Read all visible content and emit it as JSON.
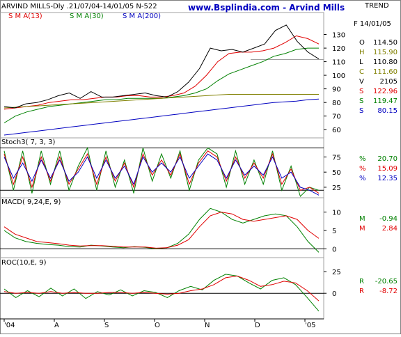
{
  "header": {
    "left_title": "ARVIND MILLS-Dly .21/07/04-14/01/05  N-522",
    "site_title": "www.Bsplindia.com - Arvind Mills",
    "trend_label": "TREND",
    "date_label": "F 14/01/05"
  },
  "colors": {
    "price": "#000000",
    "sma13": "#e00000",
    "sma30": "#008000",
    "sma200": "#0000c0",
    "extra_ma": "#808000",
    "stoch_k": "#008000",
    "stoch_d": "#e00000",
    "stoch_slow": "#0000c0",
    "site_title": "#0000c0"
  },
  "panels": {
    "price": {
      "legend": [
        {
          "text": "S M A(13)",
          "color": "#e00000"
        },
        {
          "text": "S M A(30)",
          "color": "#008000"
        },
        {
          "text": "S M A(200)",
          "color": "#0000c0"
        }
      ],
      "ohlc": [
        {
          "label": "O",
          "value": "114.50",
          "color": "#000000"
        },
        {
          "label": "H",
          "value": "115.90",
          "color": "#808000"
        },
        {
          "label": "L",
          "value": "110.80",
          "color": "#000000"
        },
        {
          "label": "C",
          "value": "111.60",
          "color": "#808000"
        },
        {
          "label": "V",
          "value": "2105",
          "color": "#000000"
        },
        {
          "label": "S",
          "value": "122.96",
          "color": "#e00000"
        },
        {
          "label": "S",
          "value": "119.47",
          "color": "#008000"
        },
        {
          "label": "S",
          "value": "80.15",
          "color": "#0000c0"
        }
      ]
    },
    "stoch": {
      "title": "Stoch3( 7, 3, 3)",
      "values": [
        {
          "label": "%",
          "value": "20.70",
          "color": "#008000"
        },
        {
          "label": "%",
          "value": "15.09",
          "color": "#e00000"
        },
        {
          "label": "%",
          "value": "12.35",
          "color": "#0000c0"
        }
      ]
    },
    "macd": {
      "title": "MACD( 9,24,E, 9)",
      "values": [
        {
          "label": "M",
          "value": "-0.94",
          "color": "#008000"
        },
        {
          "label": "M",
          "value": "2.84",
          "color": "#e00000"
        }
      ]
    },
    "roc": {
      "title": "ROC(10,E, 9)",
      "values": [
        {
          "label": "R",
          "value": "-20.65",
          "color": "#008000"
        },
        {
          "label": "R",
          "value": "-8.72",
          "color": "#e00000"
        }
      ]
    }
  },
  "chart_data": {
    "type": "line",
    "x_labels": [
      "'04",
      "A",
      "S",
      "O",
      "N",
      "D",
      "'05"
    ],
    "price": {
      "ylim": [
        55,
        140
      ],
      "yticks": [
        60,
        70,
        80,
        90,
        100,
        110,
        120,
        130
      ],
      "reference_line": 111.6,
      "series": [
        {
          "name": "S M A(13)",
          "color": "#e00000",
          "values": [
            75,
            76,
            77,
            78,
            80,
            81,
            82,
            82,
            83,
            84,
            84,
            85,
            85,
            84,
            84,
            85,
            87,
            92,
            100,
            110,
            116,
            117,
            117,
            118,
            120,
            124,
            129,
            127,
            123
          ]
        },
        {
          "name": "S M A(30)",
          "color": "#008000",
          "values": [
            65,
            70,
            73,
            75,
            77,
            78,
            79,
            80,
            81,
            82,
            82,
            83,
            83,
            83,
            83,
            84,
            85,
            87,
            90,
            96,
            101,
            104,
            107,
            110,
            114,
            116,
            119,
            120,
            120
          ]
        },
        {
          "name": "S M A(200)",
          "color": "#0000c0",
          "values": [
            56,
            57,
            58,
            59,
            60,
            61,
            62,
            63,
            64,
            65,
            66,
            67,
            68,
            69,
            70,
            71,
            72,
            73,
            74,
            75,
            76,
            77,
            78,
            79,
            80,
            80.5,
            81,
            82,
            82.5
          ]
        },
        {
          "color": "#808000",
          "values": [
            76,
            76.5,
            77,
            77.5,
            78,
            78.5,
            79,
            79.5,
            80,
            80.5,
            81,
            81.5,
            82,
            82.5,
            83,
            83.5,
            84,
            84.5,
            85,
            85.5,
            86,
            86,
            86,
            86,
            86,
            86,
            86,
            86,
            86
          ]
        },
        {
          "color": "#000000",
          "values": [
            77,
            76,
            79,
            80,
            82,
            85,
            87,
            83,
            88,
            84,
            84,
            85,
            86,
            87,
            85,
            84,
            88,
            95,
            105,
            120,
            118,
            119,
            117,
            120,
            123,
            133,
            137,
            125,
            117,
            112
          ]
        }
      ]
    },
    "stoch": {
      "ylim": [
        10,
        95
      ],
      "yticks": [
        25,
        50,
        75
      ],
      "levels": [
        20,
        90
      ],
      "series": [
        {
          "color": "#008000",
          "values": [
            85,
            20,
            85,
            15,
            85,
            30,
            85,
            20,
            60,
            90,
            20,
            85,
            25,
            70,
            15,
            90,
            35,
            80,
            40,
            85,
            20,
            70,
            90,
            80,
            25,
            85,
            30,
            70,
            30,
            85,
            20,
            60,
            10,
            25,
            20
          ]
        },
        {
          "color": "#e00000",
          "values": [
            80,
            30,
            75,
            25,
            75,
            35,
            75,
            30,
            55,
            80,
            30,
            75,
            35,
            65,
            25,
            80,
            45,
            70,
            45,
            80,
            30,
            65,
            85,
            75,
            35,
            75,
            40,
            65,
            40,
            80,
            30,
            55,
            20,
            25,
            15
          ]
        },
        {
          "color": "#0000c0",
          "values": [
            75,
            40,
            65,
            35,
            70,
            40,
            70,
            35,
            50,
            75,
            40,
            70,
            40,
            60,
            30,
            75,
            50,
            65,
            50,
            75,
            40,
            60,
            80,
            70,
            40,
            70,
            45,
            60,
            45,
            75,
            40,
            50,
            25,
            20,
            12
          ]
        }
      ]
    },
    "macd": {
      "ylim": [
        -2,
        12
      ],
      "yticks": [
        0,
        5,
        10
      ],
      "series": [
        {
          "color": "#008000",
          "values": [
            5,
            3,
            2,
            1.5,
            1.2,
            1,
            0.6,
            0.5,
            1,
            0.8,
            0.5,
            0.3,
            0.6,
            0.4,
            0,
            0.3,
            1.5,
            4,
            8,
            11,
            10,
            8,
            7,
            8,
            9,
            9.5,
            9,
            6,
            2,
            -0.94
          ]
        },
        {
          "color": "#e00000",
          "values": [
            6,
            4,
            3,
            2,
            1.7,
            1.4,
            1,
            0.8,
            0.9,
            0.9,
            0.7,
            0.5,
            0.5,
            0.5,
            0.2,
            0.3,
            1,
            2.5,
            6,
            9,
            10,
            9.5,
            8,
            7.5,
            8,
            8.5,
            9,
            8,
            5,
            2.84
          ]
        }
      ]
    },
    "roc": {
      "ylim": [
        -28,
        30
      ],
      "yticks": [
        0,
        25
      ],
      "series": [
        {
          "color": "#008000",
          "values": [
            5,
            -5,
            3,
            -4,
            6,
            -3,
            5,
            -6,
            2,
            -2,
            4,
            -3,
            3,
            1,
            -5,
            3,
            8,
            4,
            15,
            22,
            20,
            12,
            5,
            15,
            18,
            10,
            -5,
            -20.65
          ]
        },
        {
          "color": "#e00000",
          "values": [
            2,
            0,
            1,
            0,
            2,
            0,
            1,
            0,
            0,
            1,
            1,
            0,
            1,
            0,
            -1,
            0,
            3,
            5,
            10,
            18,
            20,
            15,
            8,
            10,
            14,
            12,
            3,
            -8.72
          ]
        }
      ]
    }
  }
}
